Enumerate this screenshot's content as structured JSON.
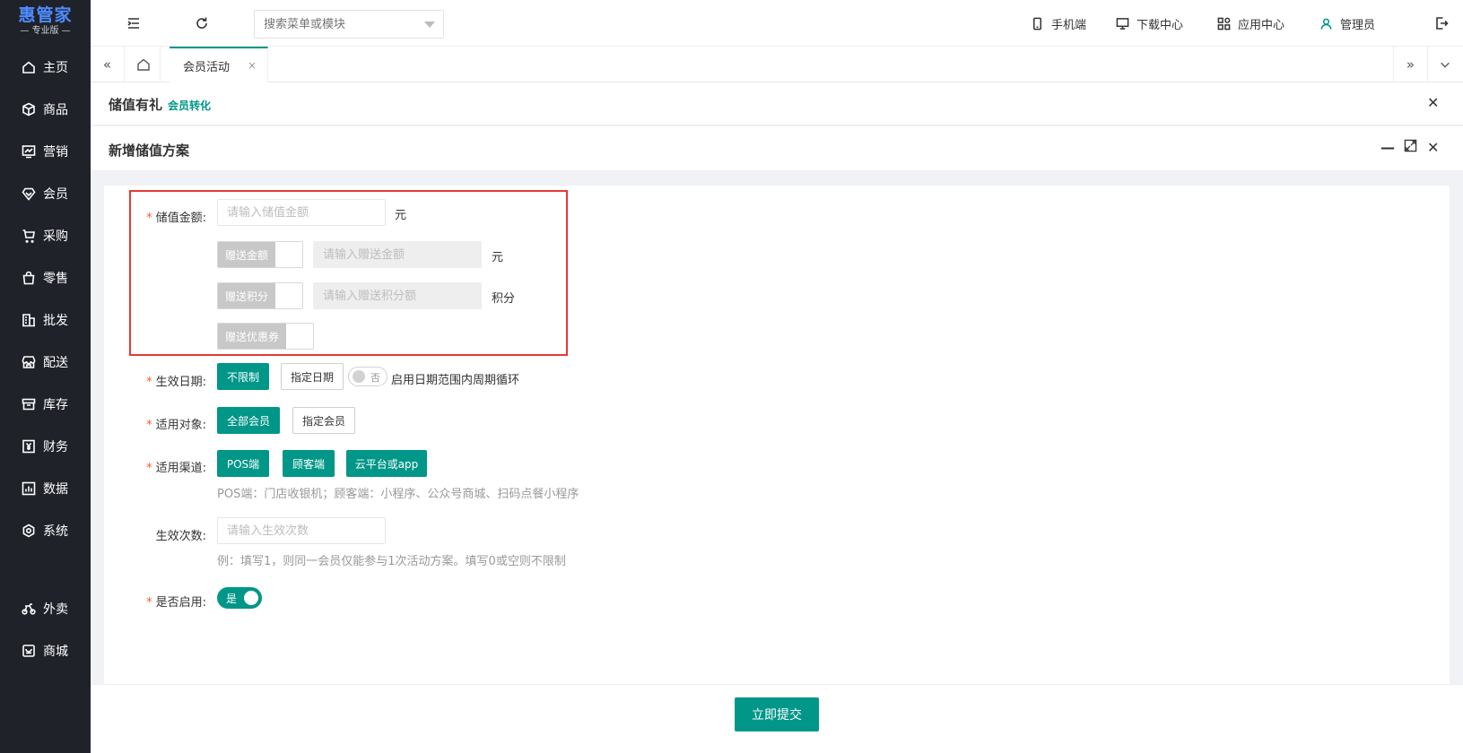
{
  "logo": {
    "title": "惠管家",
    "subtitle": "— 专业版 —"
  },
  "sidebar": {
    "items": [
      {
        "label": "主页",
        "icon": "home-icon"
      },
      {
        "label": "商品",
        "icon": "box-icon"
      },
      {
        "label": "营销",
        "icon": "chart-icon"
      },
      {
        "label": "会员",
        "icon": "diamond-icon"
      },
      {
        "label": "采购",
        "icon": "cart-icon"
      },
      {
        "label": "零售",
        "icon": "bag-icon"
      },
      {
        "label": "批发",
        "icon": "building-icon"
      },
      {
        "label": "配送",
        "icon": "store-icon"
      },
      {
        "label": "库存",
        "icon": "archive-icon"
      },
      {
        "label": "财务",
        "icon": "yen-icon"
      },
      {
        "label": "数据",
        "icon": "stats-icon"
      },
      {
        "label": "系统",
        "icon": "settings-icon"
      },
      {
        "label": "外卖",
        "icon": "bike-icon"
      },
      {
        "label": "商城",
        "icon": "shop-icon"
      }
    ]
  },
  "topbar": {
    "search_placeholder": "搜索菜单或模块",
    "mobile": "手机端",
    "download": "下载中心",
    "apps": "应用中心",
    "user": "管理员"
  },
  "tabs": {
    "active": "会员活动",
    "close": "×"
  },
  "panel1": {
    "title": "储值有礼",
    "tag": "会员转化",
    "close": "✕"
  },
  "panel2": {
    "title": "新增储值方案",
    "minimize": "—",
    "close": "✕"
  },
  "form": {
    "amount": {
      "label": "储值金额:",
      "placeholder": "请输入储值金额",
      "unit": "元"
    },
    "gift_amount": {
      "switch_label": "赠送金额",
      "placeholder": "请输入赠送金额",
      "unit": "元"
    },
    "gift_points": {
      "switch_label": "赠送积分",
      "placeholder": "请输入赠送积分额",
      "unit": "积分"
    },
    "gift_coupon": {
      "switch_label": "赠送优惠券"
    },
    "effective_date": {
      "label": "生效日期:",
      "opt1": "不限制",
      "opt2": "指定日期",
      "toggle_text": "否",
      "cycle_label": "启用日期范围内周期循环"
    },
    "target": {
      "label": "适用对象:",
      "opt1": "全部会员",
      "opt2": "指定会员"
    },
    "channel": {
      "label": "适用渠道:",
      "opt1": "POS端",
      "opt2": "顾客端",
      "opt3": "云平台或app",
      "hint": "POS端：门店收银机；顾客端：小程序、公众号商城、扫码点餐小程序"
    },
    "times": {
      "label": "生效次数:",
      "placeholder": "请输入生效次数",
      "hint": "例：填写1，则同一会员仅能参与1次活动方案。填写0或空则不限制"
    },
    "enabled": {
      "label": "是否启用:",
      "toggle_text": "是"
    }
  },
  "footer": {
    "submit": "立即提交"
  },
  "colors": {
    "primary": "#009688",
    "sidebar": "#20222a",
    "highlight": "#e53935",
    "logo": "#4e8cff"
  }
}
